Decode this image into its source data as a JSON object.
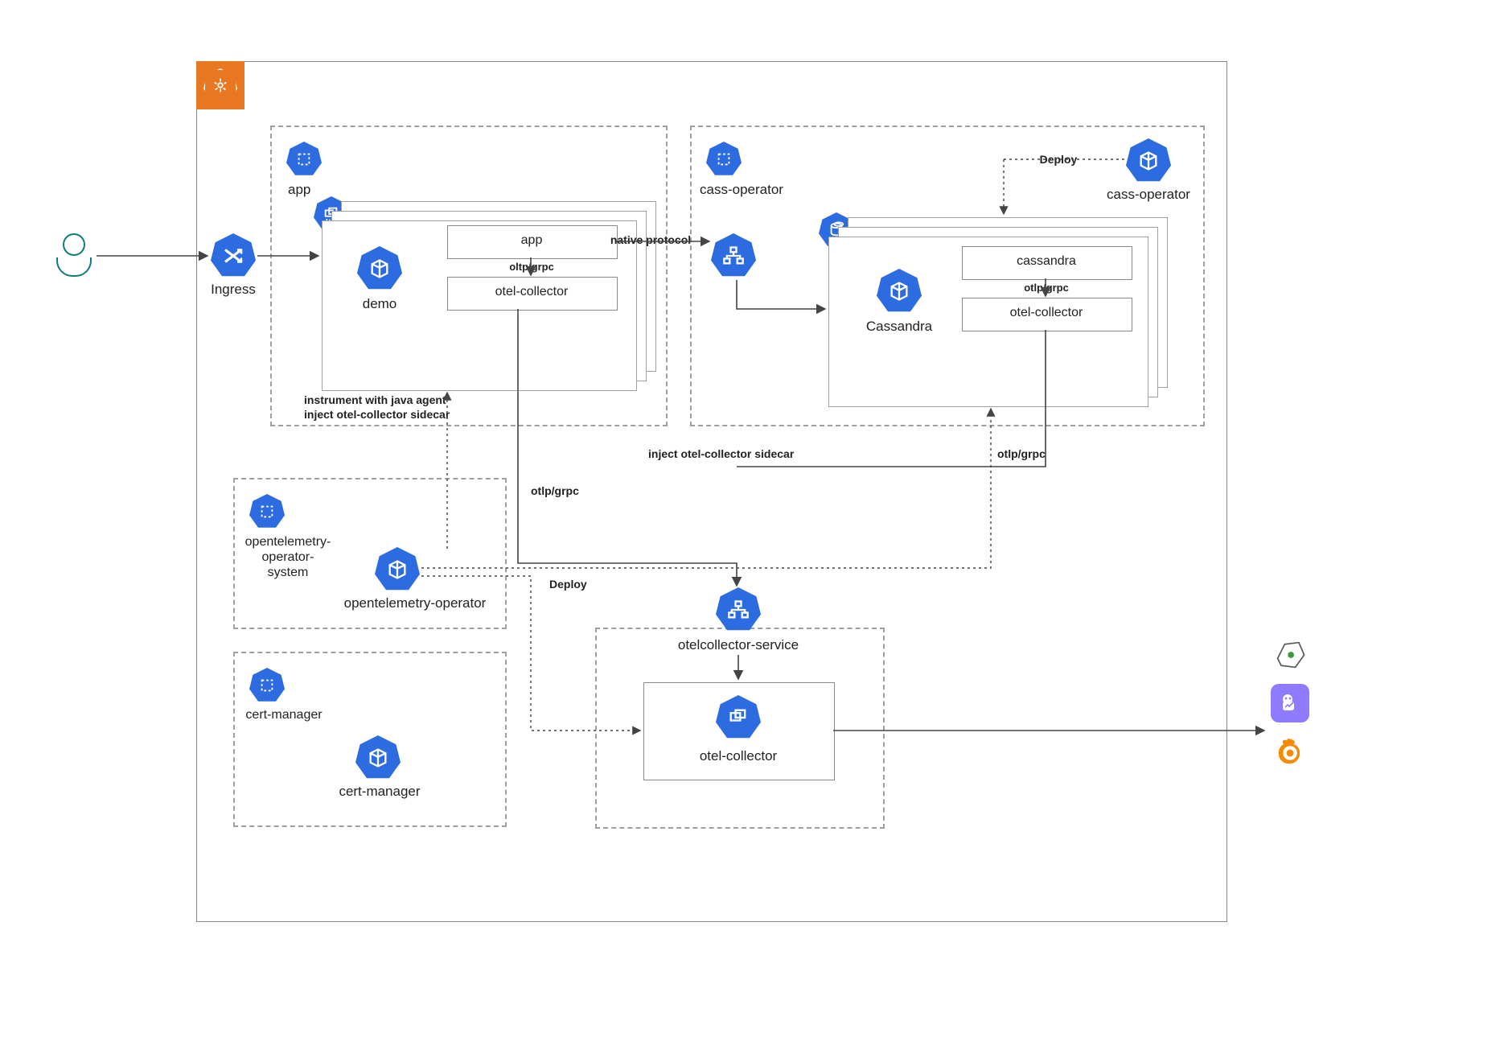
{
  "colors": {
    "accent": "#2d6be0",
    "k8s": "#e87722",
    "teal": "#117a7a",
    "jaeger": "#8e7bff",
    "grafana": "#f58b00"
  },
  "user": {
    "role": "end-user"
  },
  "ingress": {
    "label": "Ingress"
  },
  "cluster": {
    "platform": "Kubernetes",
    "namespaces": {
      "app": {
        "ns_label": "app",
        "deployment": "demo",
        "pod_containers": {
          "app": "app",
          "sidecar": "otel-collector",
          "edge": "oltp/grpc"
        }
      },
      "cass_operator": {
        "ns_label": "cass-operator",
        "operator_label": "cass-operator",
        "operator_edge": "Deploy",
        "statefulset": "Cassandra",
        "pod_containers": {
          "db": "cassandra",
          "sidecar": "otel-collector",
          "edge": "otlp/grpc"
        }
      },
      "otel_operator": {
        "ns_label": "opentelemetry-\noperator-\nsystem",
        "operator_label": "opentelemetry-operator",
        "deploy_edge": "Deploy"
      },
      "cert_manager": {
        "ns_label": "cert-manager",
        "deploy_label": "cert-manager"
      },
      "collector": {
        "service_label": "otelcollector-service",
        "pod_label": "otel-collector"
      }
    }
  },
  "edges": {
    "native_protocol": "native protocol",
    "instrument": "instrument with java agent\ninject otel-collector sidecar",
    "inject_sidecar": "inject otel-collector sidecar",
    "otlp_left": "otlp/grpc",
    "otlp_right": "otlp/grpc"
  },
  "sinks": {
    "opentelemetry": "OpenTelemetry",
    "jaeger": "Jaeger",
    "grafana": "Grafana"
  }
}
